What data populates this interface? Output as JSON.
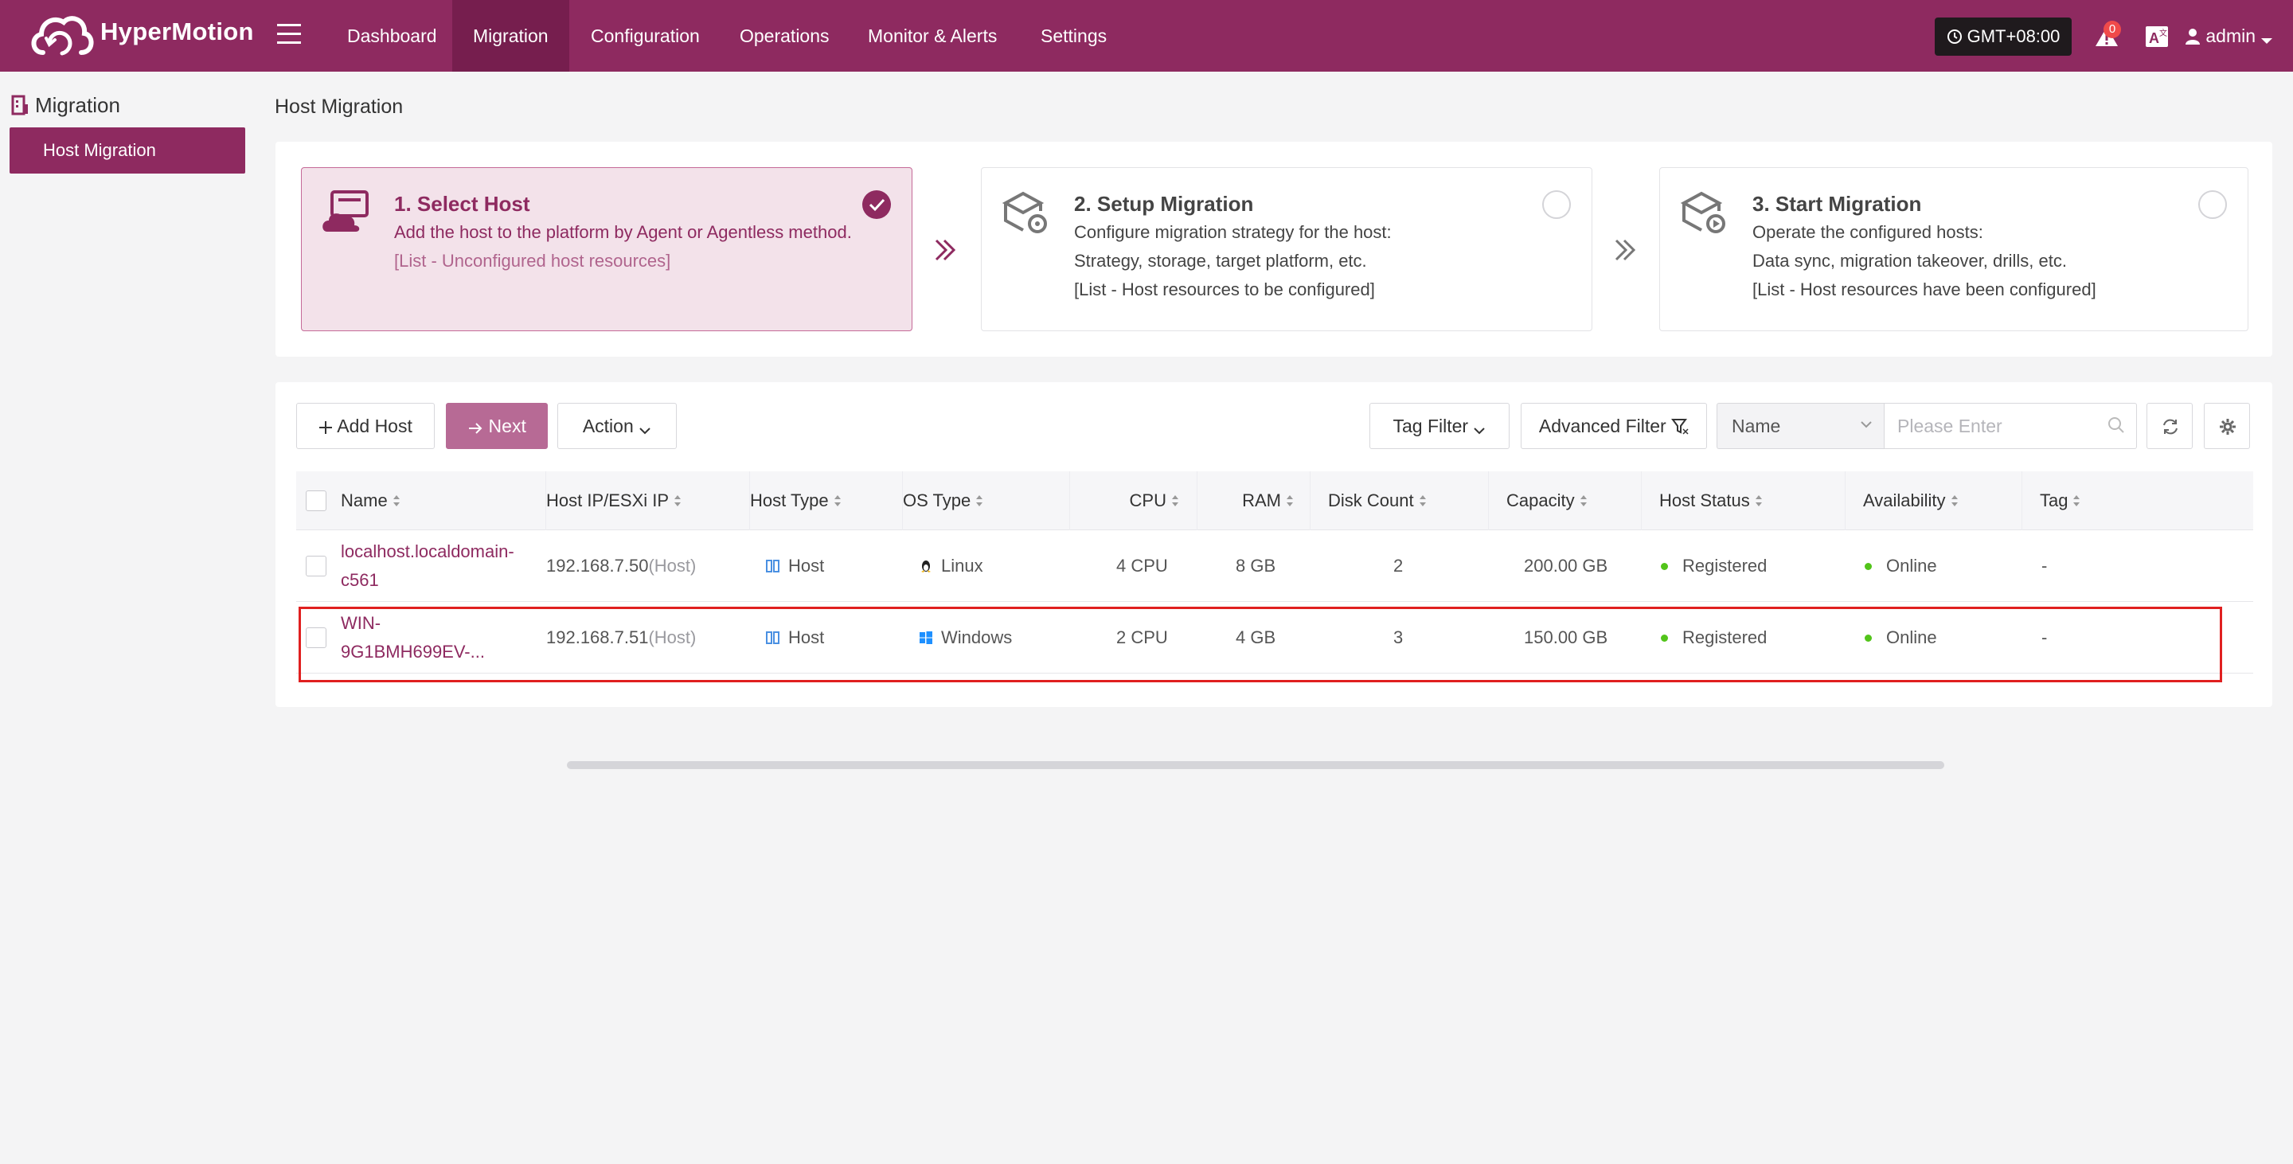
{
  "app": {
    "brand": "HyperMotion"
  },
  "nav": {
    "items": [
      {
        "label": "Dashboard",
        "active": false
      },
      {
        "label": "Migration",
        "active": true
      },
      {
        "label": "Configuration",
        "active": false
      },
      {
        "label": "Operations",
        "active": false
      },
      {
        "label": "Monitor & Alerts",
        "active": false
      },
      {
        "label": "Settings",
        "active": false
      }
    ],
    "timezone": "GMT+08:00",
    "alert_count": "0",
    "user": "admin"
  },
  "sidebar": {
    "section": "Migration",
    "items": [
      {
        "label": "Host Migration",
        "active": true
      }
    ]
  },
  "page": {
    "title": "Host Migration"
  },
  "steps": [
    {
      "title": "1. Select Host",
      "lines": [
        "Add the host to the platform by Agent or Agentless method.",
        "[List - Unconfigured host resources]"
      ],
      "state": "done"
    },
    {
      "title": "2. Setup Migration",
      "lines": [
        "Configure migration strategy for the host:",
        "Strategy, storage, target platform, etc.",
        "[List - Host resources to be configured]"
      ],
      "state": "pending"
    },
    {
      "title": "3. Start Migration",
      "lines": [
        "Operate the configured hosts:",
        "Data sync, migration takeover, drills, etc.",
        "[List - Host resources have been configured]"
      ],
      "state": "pending"
    }
  ],
  "toolbar": {
    "add_host": "Add Host",
    "next": "Next",
    "action": "Action",
    "tag_filter": "Tag Filter",
    "advanced_filter": "Advanced Filter",
    "search_field": "Name",
    "search_placeholder": "Please Enter"
  },
  "table": {
    "columns": [
      "Name",
      "Host IP/ESXi IP",
      "Host Type",
      "OS Type",
      "CPU",
      "RAM",
      "Disk Count",
      "Capacity",
      "Host Status",
      "Availability",
      "Tag"
    ],
    "rows": [
      {
        "name": "localhost.localdomain-c561",
        "ip": "192.168.7.50",
        "ip_suffix": "(Host)",
        "host_type": "Host",
        "os_type": "Linux",
        "os_icon": "linux-icon",
        "cpu": "4 CPU",
        "ram": "8 GB",
        "disk_count": "2",
        "capacity": "200.00 GB",
        "host_status": "Registered",
        "availability": "Online",
        "tag": "-"
      },
      {
        "name": "WIN-9G1BMH699EV-...",
        "ip": "192.168.7.51",
        "ip_suffix": "(Host)",
        "host_type": "Host",
        "os_type": "Windows",
        "os_icon": "windows-icon",
        "cpu": "2 CPU",
        "ram": "4 GB",
        "disk_count": "3",
        "capacity": "150.00 GB",
        "host_status": "Registered",
        "availability": "Online",
        "tag": "-"
      }
    ]
  },
  "colors": {
    "brand": "#8e2a60",
    "status_online": "#52c41a",
    "highlight": "#e02020"
  }
}
